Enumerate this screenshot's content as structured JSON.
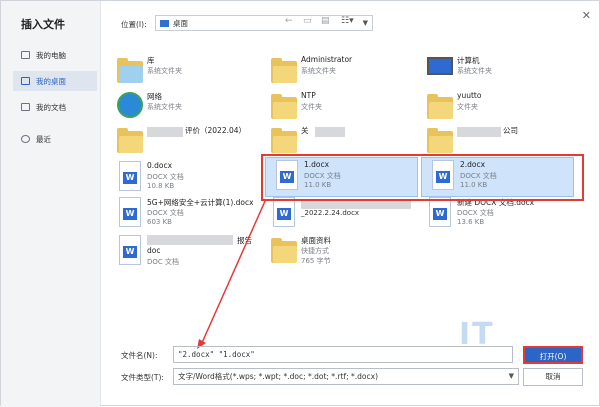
{
  "dialog": {
    "title": "插入文件"
  },
  "sidebar": {
    "items": [
      {
        "label": "我的电脑"
      },
      {
        "label": "我的桌面"
      },
      {
        "label": "我的文档"
      },
      {
        "label": "最近"
      }
    ]
  },
  "toolbar": {
    "location_label": "位置(I):",
    "location_value": "桌面"
  },
  "files": [
    {
      "name": "库",
      "type": "系统文件夹",
      "size": ""
    },
    {
      "name": "Administrator",
      "type": "系统文件夹",
      "size": ""
    },
    {
      "name": "计算机",
      "type": "系统文件夹",
      "size": ""
    },
    {
      "name": "网络",
      "type": "系统文件夹",
      "size": ""
    },
    {
      "name": "NTP",
      "type": "文件夹",
      "size": ""
    },
    {
      "name": "yuutto",
      "type": "文件夹",
      "size": ""
    },
    {
      "name": "评价（2022.04）",
      "type": "",
      "size": ""
    },
    {
      "name": "关",
      "type": "",
      "size": ""
    },
    {
      "name": "公司",
      "type": "",
      "size": ""
    },
    {
      "name": "0.docx",
      "type": "DOCX 文档",
      "size": "10.8 KB"
    },
    {
      "name": "1.docx",
      "type": "DOCX 文档",
      "size": "11.0 KB"
    },
    {
      "name": "2.docx",
      "type": "DOCX 文档",
      "size": "11.0 KB"
    },
    {
      "name": "5G+网络安全+云计算(1).docx",
      "type": "DOCX 文档",
      "size": "603 KB"
    },
    {
      "name": "_2022.2.24.docx",
      "type": "",
      "size": ""
    },
    {
      "name": "新建 DOCX 文档.docx",
      "type": "DOCX 文档",
      "size": "13.6 KB"
    },
    {
      "name": "doc",
      "type": "DOC 文档",
      "size": ""
    },
    {
      "name": "桌面资料",
      "type": "快捷方式",
      "size": "765 字节"
    }
  ],
  "blurred_suffix": "报告",
  "bottom": {
    "filename_label": "文件名(N):",
    "filename_value": "\"2.docx\" \"1.docx\"",
    "filetype_label": "文件类型(T):",
    "filetype_value": "文字/Word格式(*.wps; *.wpt; *.doc; *.dot; *.rtf; *.docx)",
    "open_label": "打开(O)",
    "cancel_label": "取消"
  },
  "watermark": "IT",
  "colors": {
    "accent": "#2b65c5",
    "highlight": "#e53935",
    "selection": "#cfe3fb"
  }
}
